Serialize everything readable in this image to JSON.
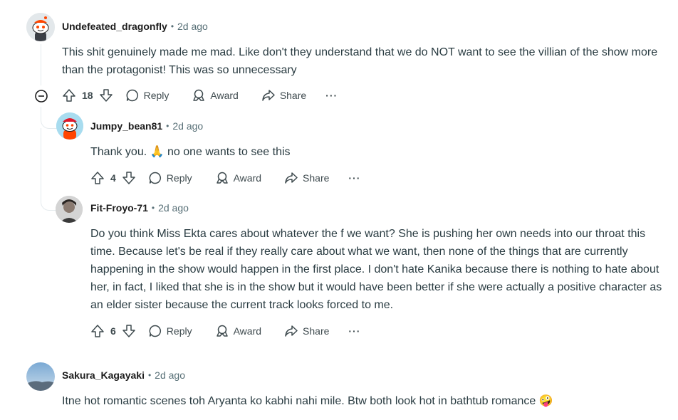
{
  "comments": [
    {
      "author": "Undefeated_dragonfly",
      "time": "2d ago",
      "text": "This shit genuinely made me mad. Like don't they understand that we do NOT want to see the villian of the show more than the protagonist! This was so unnecessary",
      "votes": "18",
      "reply": "Reply",
      "award": "Award",
      "share": "Share",
      "more": "···"
    },
    {
      "author": "Jumpy_bean81",
      "time": "2d ago",
      "text_before": "Thank you.",
      "text_after": "no one wants to see this",
      "votes": "4",
      "reply": "Reply",
      "award": "Award",
      "share": "Share",
      "more": "···"
    },
    {
      "author": "Fit-Froyo-71",
      "time": "2d ago",
      "text": "Do you think Miss Ekta cares about whatever the f we want? She is pushing her own needs into our throat this time. Because let's be real if they really care about what we want, then none of the things that are currently happening in the show would happen in the first place. I don't hate Kanika because there is nothing to hate about her, in fact, I liked that she is in the show but it would have been better if she were actually a positive character as an elder sister because the current track looks forced to me.",
      "votes": "6",
      "reply": "Reply",
      "award": "Award",
      "share": "Share",
      "more": "···"
    },
    {
      "author": "Sakura_Kagayaki",
      "time": "2d ago",
      "text": "Itne hot romantic scenes toh Aryanta ko kabhi nahi mile. Btw both look hot in bathtub romance",
      "emoji": "🤪"
    }
  ],
  "icons": {
    "collapse": "minus-circle-icon",
    "upvote": "arrow-up-icon",
    "downvote": "arrow-down-icon",
    "reply": "speech-bubble-icon",
    "award": "award-icon",
    "share": "share-arrow-icon",
    "pray_emoji": "🙏"
  },
  "colors": {
    "text": "#2a3c42",
    "meta": "#576f76",
    "thread_line": "#e5ebee",
    "snoo_orange": "#ff4500"
  }
}
